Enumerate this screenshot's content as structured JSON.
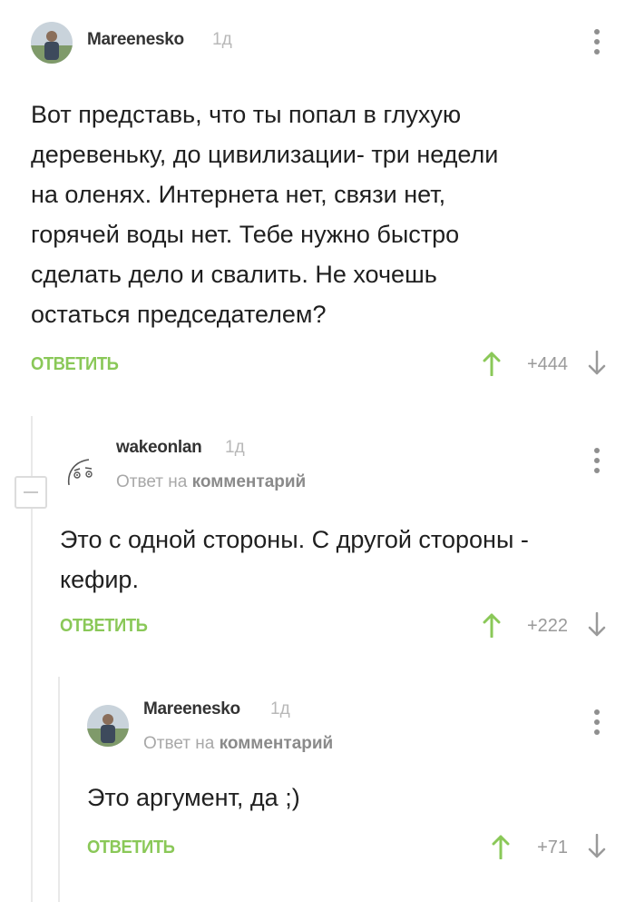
{
  "comments": [
    {
      "author": "Mareenesko",
      "time": "1д",
      "text_lines": [
        "Вот представь, что ты попал в глухую",
        "деревеньку, до цивилизации- три недели",
        "на оленях. Интернета нет, связи нет,",
        "горячей воды нет. Тебе нужно быстро",
        "сделать дело и свалить. Не хочешь",
        "остаться председателем?"
      ],
      "reply_label": "ОТВЕТИТЬ",
      "score": "+444"
    },
    {
      "author": "wakeonlan",
      "time": "1д",
      "reply_prefix": "Ответ на",
      "reply_target": "комментарий",
      "text_lines": [
        "Это с одной стороны. С другой стороны -",
        "кефир."
      ],
      "reply_label": "ОТВЕТИТЬ",
      "score": "+222"
    },
    {
      "author": "Mareenesko",
      "time": "1д",
      "reply_prefix": "Ответ на",
      "reply_target": "комментарий",
      "text_lines": [
        "Это аргумент, да ;)"
      ],
      "reply_label": "ОТВЕТИТЬ",
      "score": "+71"
    }
  ],
  "colors": {
    "accent_green": "#8ac858",
    "vote_up": "#8ac858",
    "vote_down": "#9a9a9a",
    "meta_gray": "#b8b8b8"
  },
  "icons": {
    "vote_up": "arrow-up-icon",
    "vote_down": "arrow-down-icon",
    "menu": "more-vertical-icon",
    "collapse": "minus-icon"
  }
}
